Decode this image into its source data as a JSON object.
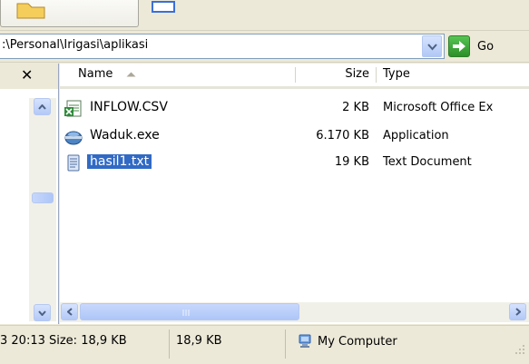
{
  "address": {
    "path": ":\\Personal\\Irigasi\\aplikasi",
    "go_label": "Go"
  },
  "folders_pane": {
    "close_label": "✕"
  },
  "columns": {
    "name": "Name",
    "size": "Size",
    "type": "Type"
  },
  "files": [
    {
      "name": "INFLOW.CSV",
      "size": "2 KB",
      "type": "Microsoft Office Ex",
      "icon": "excel-csv-icon",
      "selected": false
    },
    {
      "name": "Waduk.exe",
      "size": "6.170 KB",
      "type": "Application",
      "icon": "application-icon",
      "selected": false
    },
    {
      "name": "hasil1.txt",
      "size": "19 KB",
      "type": "Text Document",
      "icon": "text-document-icon",
      "selected": true
    }
  ],
  "status": {
    "details": "3 20:13 Size: 18,9 KB",
    "size": "18,9 KB",
    "location": "My Computer"
  },
  "colors": {
    "selection": "#316ac5",
    "window_bg": "#ece9d8",
    "go_green": "#2c8f28",
    "scroll_blue": "#c1d3fb"
  }
}
